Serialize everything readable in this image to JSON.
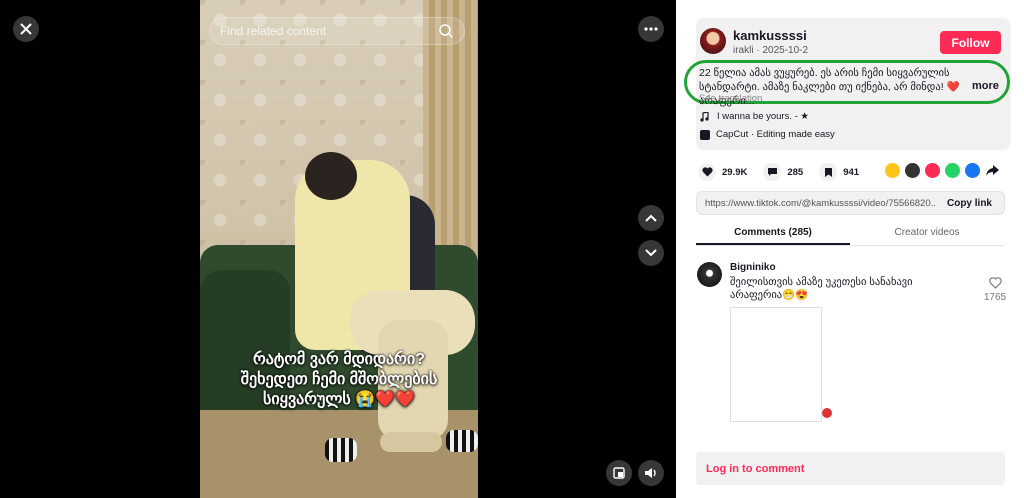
{
  "search": {
    "placeholder": "Find related content"
  },
  "video": {
    "caption": "რატომ ვარ მდიდარი?\nშეხედეთ ჩემი მშობლების\nსიყვარულს 😭❤️❤️"
  },
  "post": {
    "username": "kamkussssi",
    "subline": "irakli · 2025-10-2",
    "follow_label": "Follow",
    "description": "22 წელია ამას ვუყურებ. ეს არის ჩემი სიყვარულის სტანდარტი. ამაზე ნაკლები თუ იქნება, არ მინდა! ❤️ არაფერი...",
    "more_label": "more",
    "see_translation": "See translation",
    "music": "I wanna be yours. - ★",
    "capcut": "CapCut · Editing made easy"
  },
  "stats": {
    "likes": "29.9K",
    "comments": "285",
    "saves": "941"
  },
  "share_colors": [
    "#fec419",
    "#333333",
    "#fe2c55",
    "#25d366",
    "#1877f2"
  ],
  "link": {
    "url": "https://www.tiktok.com/@kamkussssi/video/75566820...",
    "copy_label": "Copy link"
  },
  "tabs": {
    "comments": "Comments (285)",
    "creator_videos": "Creator videos"
  },
  "comment": {
    "user": "Bigniniko",
    "text": "შეილისთვის ამაზე უკეთესი სანახავი არაფერია😁😍",
    "likes": "1765"
  },
  "login": {
    "label": "Log in to comment"
  },
  "icons": [
    "close-icon",
    "more-icon",
    "chevron-up-icon",
    "chevron-down-icon",
    "pip-icon",
    "volume-icon",
    "search-icon",
    "heart-icon",
    "comment-icon",
    "bookmark-icon",
    "music-icon"
  ]
}
